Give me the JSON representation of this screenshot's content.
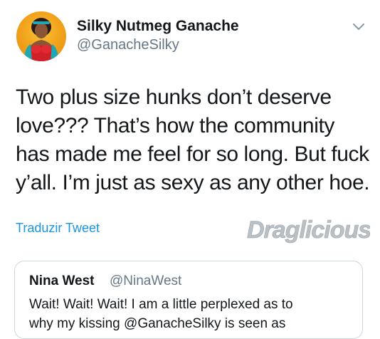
{
  "tweet": {
    "author": {
      "display_name": "Silky Nutmeg Ganache",
      "handle": "@GanacheSilky",
      "avatar_icon": "profile-photo"
    },
    "menu_icon": "chevron-down-icon",
    "text_lines": [
      "Two plus size hunks don’t deserve",
      "love???  That’s how the community",
      "has made me feel for so long.  But fuck",
      "y’all. I’m just as sexy as any other hoe."
    ],
    "translate_label": "Traduzir Tweet"
  },
  "watermark": {
    "text": "Draglicious"
  },
  "quoted_tweet": {
    "display_name": "Nina West",
    "handle": "@NinaWest",
    "text_lines": [
      "Wait! Wait! Wait! I am a little perplexed as to",
      "why my kissing @GanacheSilky is seen as"
    ]
  },
  "colors": {
    "link": "#1b95e0",
    "secondary_text": "#657786",
    "border": "#ccd6dd"
  }
}
